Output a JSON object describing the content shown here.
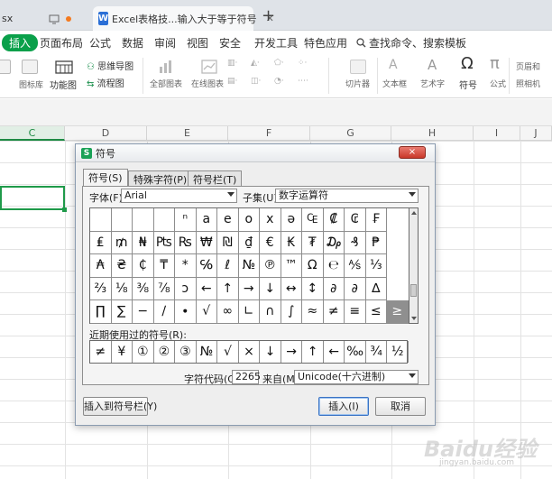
{
  "tabs": [
    {
      "label": "sx"
    },
    {
      "label": "Excel表格技...输入大于等于符号",
      "logo": "W"
    }
  ],
  "menu": [
    "插入",
    "页面布局",
    "公式",
    "数据",
    "审阅",
    "视图",
    "安全",
    "开发工具",
    "特色应用"
  ],
  "search_label": "查找命令、搜索模板",
  "ribbon": {
    "labels": [
      "图标库",
      "功能图",
      "全部图表",
      "在线图表",
      "切片器",
      "文本框",
      "艺术字",
      "符号",
      "公式"
    ],
    "mind_map": "思维导图",
    "flow_chart": "流程图",
    "page_header": "页眉和",
    "photo": "照相机"
  },
  "columns": [
    "C",
    "D",
    "E",
    "F",
    "G",
    "H",
    "I",
    "J"
  ],
  "dialog": {
    "title": "符号",
    "close_label": "×",
    "tabs": [
      "符号(S)",
      "特殊字符(P)",
      "符号栏(T)"
    ],
    "font_label": "字体(F):",
    "font_value": "Arial",
    "subset_label": "子集(U):",
    "subset_value": "数字运算符",
    "symbols": [
      [
        "",
        "",
        "",
        "",
        "ⁿ",
        "a",
        "e",
        "o",
        "x",
        "ə",
        "₠",
        "₡",
        "₢",
        "₣"
      ],
      [
        "₤",
        "₥",
        "₦",
        "₧",
        "₨",
        "₩",
        "₪",
        "₫",
        "€",
        "₭",
        "₮",
        "₯",
        "₰",
        "₱"
      ],
      [
        "₳",
        "₴",
        "₵",
        "₸",
        "*",
        "℅",
        "ℓ",
        "№",
        "℗",
        "™",
        "Ω",
        "℮",
        "⅍",
        "⅓"
      ],
      [
        "⅔",
        "⅛",
        "⅜",
        "⅞",
        "ↄ",
        "←",
        "↑",
        "→",
        "↓",
        "↔",
        "↕",
        "∂",
        "∂",
        "∆"
      ],
      [
        "∏",
        "∑",
        "−",
        "∕",
        "∙",
        "√",
        "∞",
        "∟",
        "∩",
        "∫",
        "≈",
        "≠",
        "≡",
        "≤",
        "≥"
      ]
    ],
    "recent_label": "近期使用过的符号(R):",
    "recent": [
      "≠",
      "¥",
      "①",
      "②",
      "③",
      "№",
      "√",
      "×",
      "↓",
      "→",
      "↑",
      "←",
      "‰",
      "¾",
      "½"
    ],
    "code_label": "字符代码(C):",
    "code_value": "2265",
    "from_label": "来自(M)",
    "from_value": "Unicode(十六进制)",
    "btn_toolbar": "插入到符号栏(Y)",
    "btn_insert": "插入(I)",
    "btn_cancel": "取消"
  },
  "watermark": "Baidu经验",
  "watermark_sub": "jingyan.baidu.com"
}
